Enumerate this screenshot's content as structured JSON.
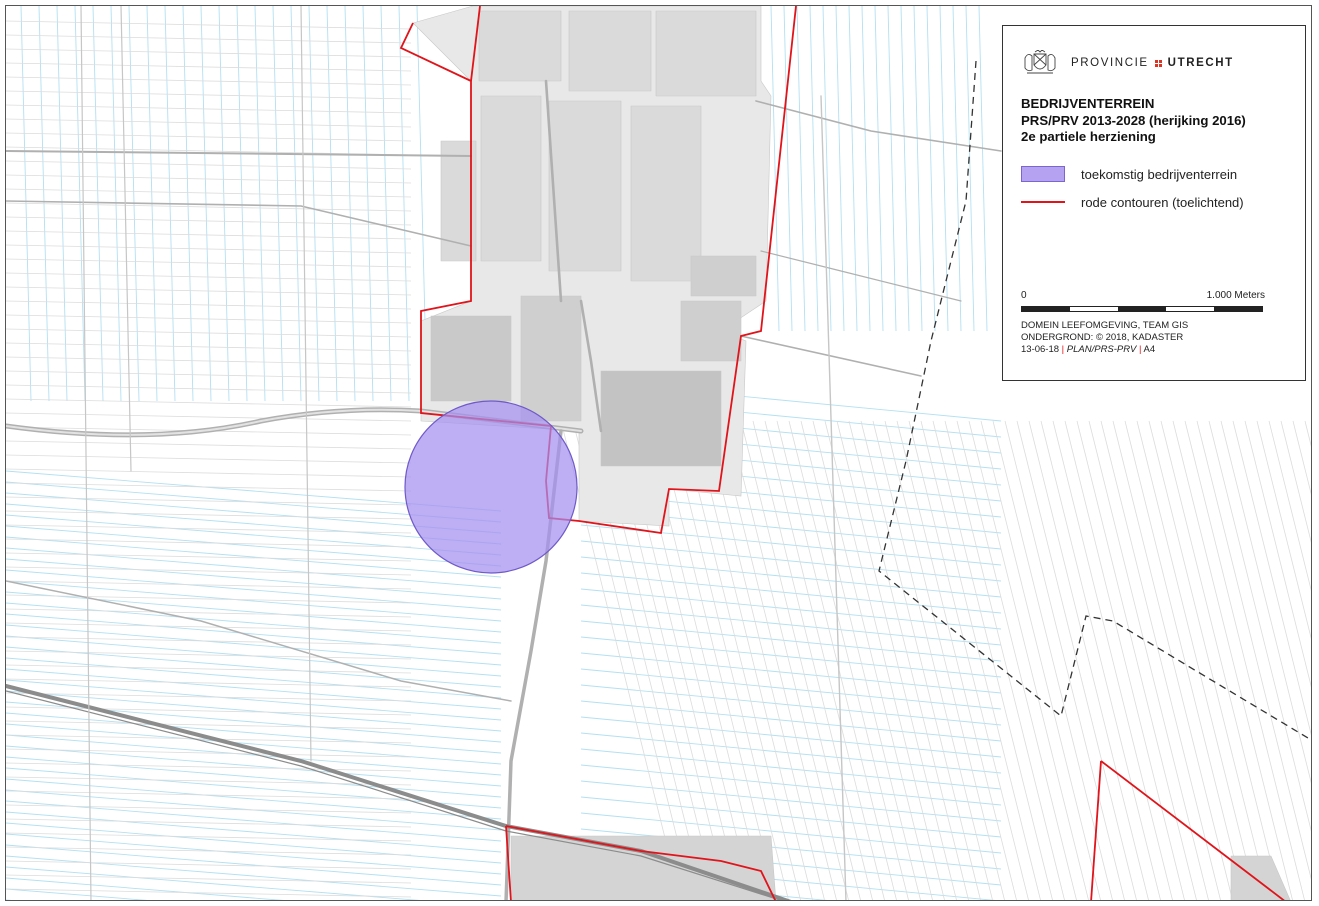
{
  "logo": {
    "org_word": "PROVINCIE",
    "org_city": "UTRECHT",
    "crest_icon": "coat-of-arms-icon",
    "dots_color": "#d42e24"
  },
  "legend": {
    "title_line1": "BEDRIJVENTERREIN",
    "title_line2": "PRS/PRV 2013-2028 (herijking 2016)",
    "title_line3": "2e partiele herziening",
    "items": [
      {
        "label": "toekomstig bedrijventerrein",
        "color": "#b5a3f2",
        "kind": "fill"
      },
      {
        "label": "rode contouren (toelichtend)",
        "color": "#e0141a",
        "kind": "line"
      }
    ]
  },
  "scalebar": {
    "left_label": "0",
    "right_label": "1.000 Meters"
  },
  "credits": {
    "line1": "DOMEIN LEEFOMGEVING, TEAM GIS",
    "line2": "ONDERGROND: © 2018, KADASTER",
    "date": "13-06-18",
    "plan": "PLAN/PRS-PRV",
    "format": "A4",
    "separator": "|"
  },
  "colors": {
    "water": "#a8dcef",
    "road": "#b4b4b4",
    "built": "#dadada",
    "contour": "#e0141a",
    "boundary": "#333333"
  }
}
